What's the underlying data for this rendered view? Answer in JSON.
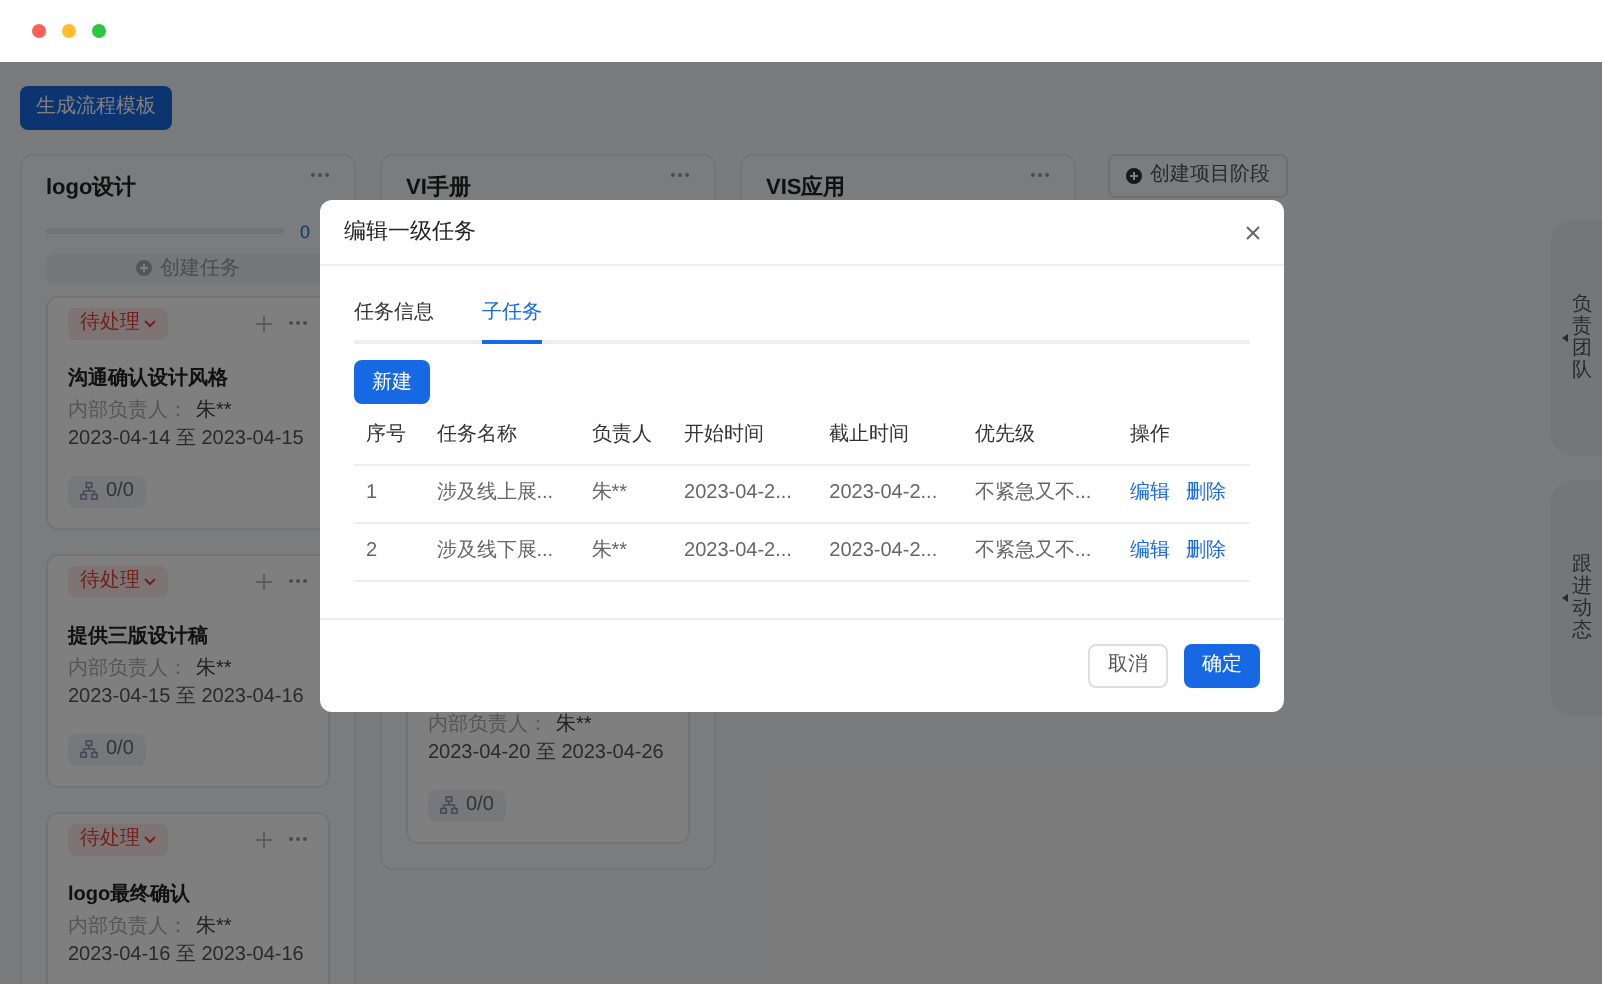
{
  "window": {
    "controls": [
      {
        "color": "#ff5f57"
      },
      {
        "color": "#febc2e"
      },
      {
        "color": "#28c840"
      }
    ]
  },
  "toolbar": {
    "generate_button": "生成流程模板",
    "create_stage_button": "创建项目阶段"
  },
  "columns": [
    {
      "title": "logo设计",
      "progress": {
        "reading": "0"
      },
      "create_task_button": "创建任务",
      "cards": [
        {
          "status": "待处理",
          "title": "沟通确认设计风格",
          "owner_label": "内部负责人：",
          "owner": "朱**",
          "dates": "2023-04-14 至 2023-04-15",
          "subtasks": "0/0"
        },
        {
          "status": "待处理",
          "title": "提供三版设计稿",
          "owner_label": "内部负责人：",
          "owner": "朱**",
          "dates": "2023-04-15 至 2023-04-16",
          "subtasks": "0/0"
        },
        {
          "status": "待处理",
          "title": "logo最终确认",
          "owner_label": "内部负责人：",
          "owner": "朱**",
          "dates": "2023-04-16 至 2023-04-16"
        }
      ]
    },
    {
      "title": "VI手册",
      "cards": [
        {
          "owner_label": "内部负责人：",
          "owner": "朱**",
          "dates": "2023-04-20 至 2023-04-26",
          "subtasks": "0/0"
        }
      ]
    },
    {
      "title": "VIS应用"
    }
  ],
  "side_tabs": [
    "负责团队",
    "跟进动态"
  ],
  "modal": {
    "title": "编辑一级任务",
    "tabs": [
      {
        "label": "任务信息",
        "selected": false
      },
      {
        "label": "子任务",
        "selected": true
      }
    ],
    "new_button": "新建",
    "table": {
      "columns": [
        "序号",
        "任务名称",
        "负责人",
        "开始时间",
        "截止时间",
        "优先级",
        "操作"
      ],
      "rows": [
        {
          "cells": [
            "1",
            "涉及线上展...",
            "朱**",
            "2023-04-2...",
            "2023-04-2...",
            "不紧急又不..."
          ],
          "actions": [
            "编辑",
            "删除"
          ]
        },
        {
          "cells": [
            "2",
            "涉及线下展...",
            "朱**",
            "2023-04-2...",
            "2023-04-2...",
            "不紧急又不..."
          ],
          "actions": [
            "编辑",
            "删除"
          ]
        }
      ]
    },
    "cancel_button": "取消",
    "confirm_button": "确定"
  }
}
